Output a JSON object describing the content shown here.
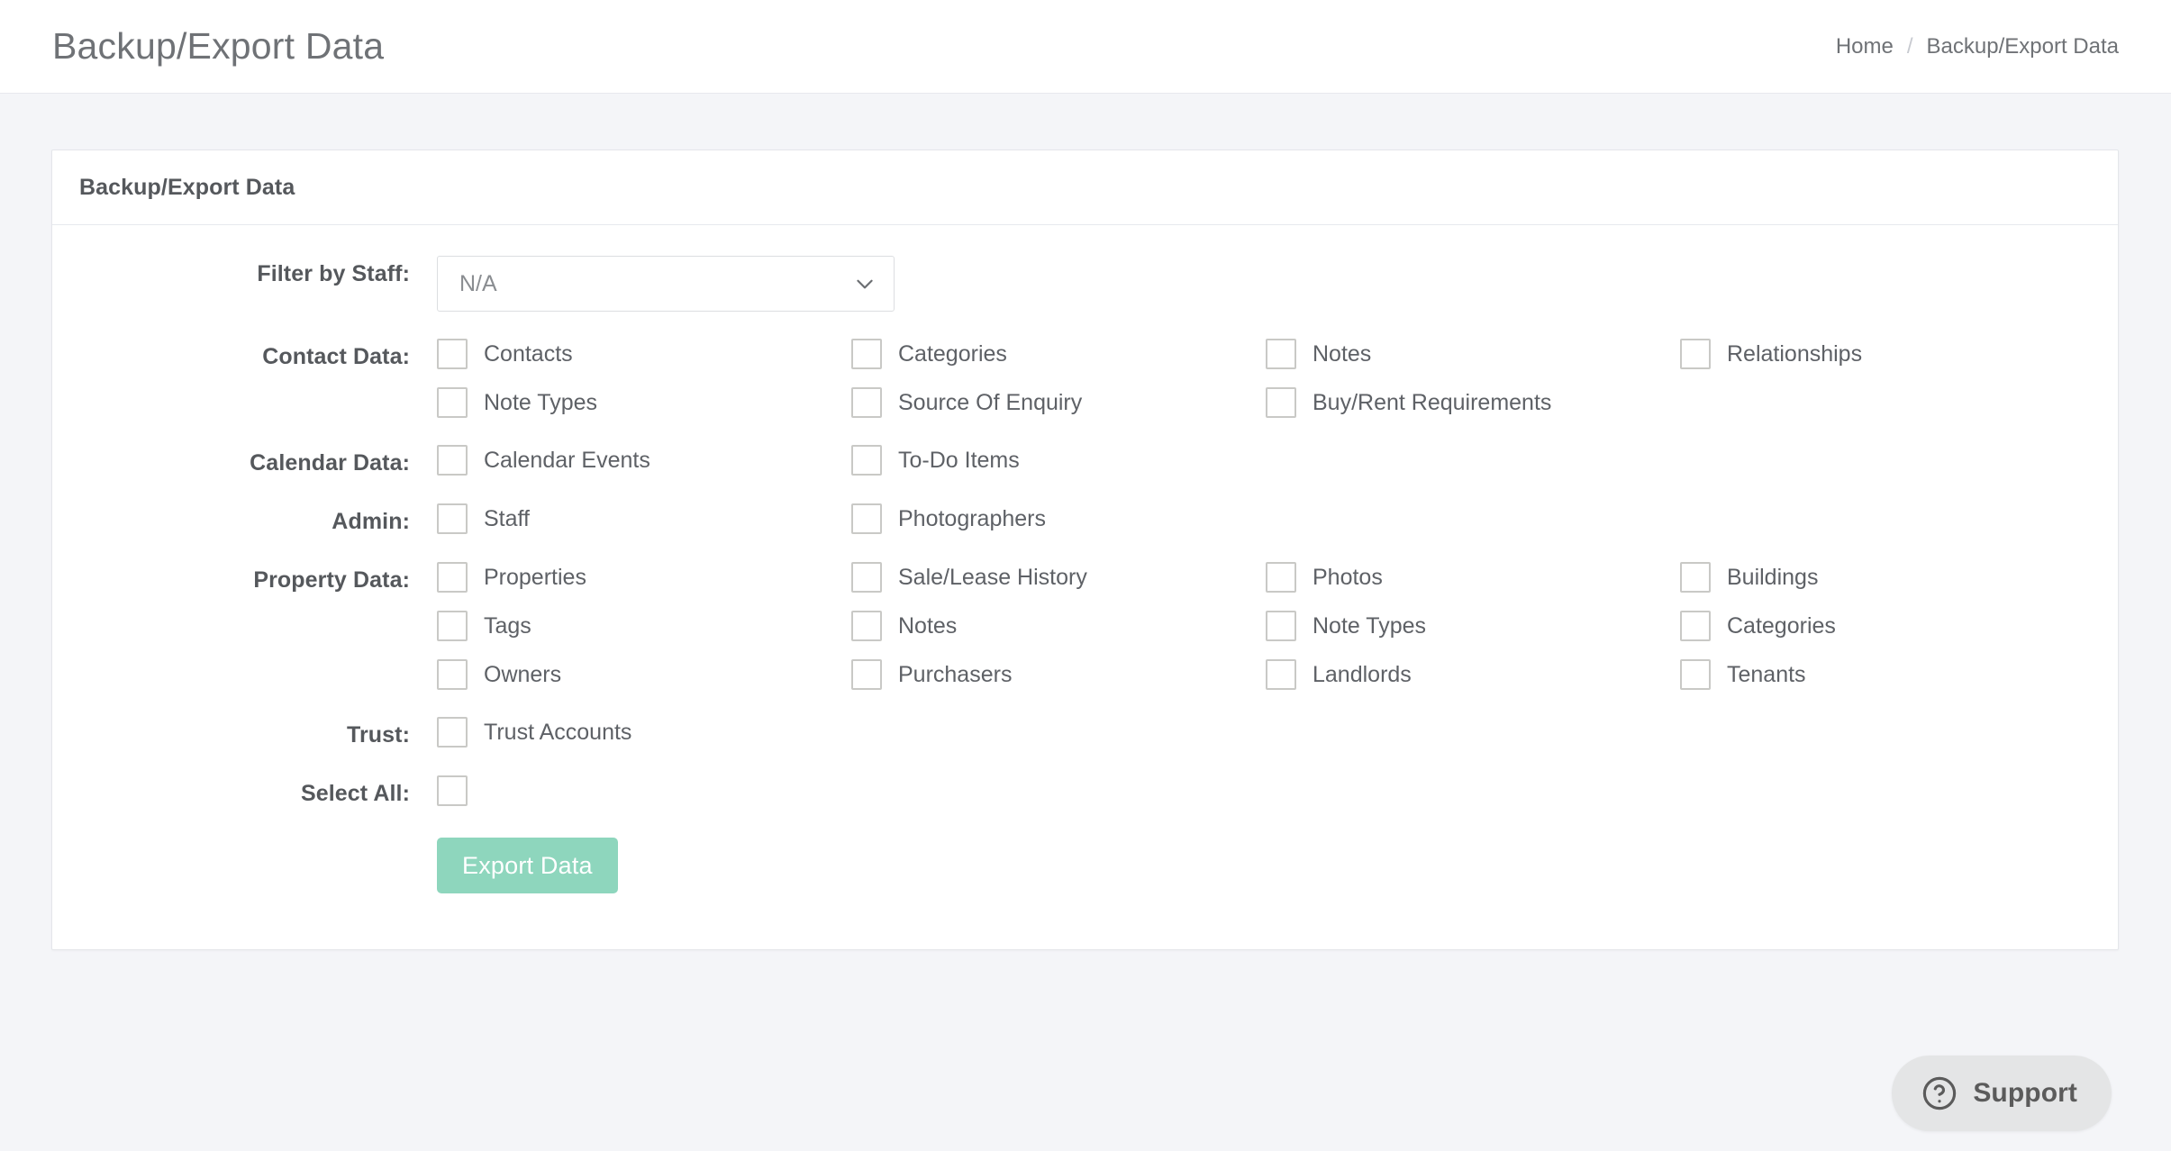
{
  "header": {
    "page_title": "Backup/Export Data",
    "breadcrumb": {
      "home": "Home",
      "separator": "/",
      "current": "Backup/Export Data"
    }
  },
  "card": {
    "title": "Backup/Export Data"
  },
  "form": {
    "filter_by_staff": {
      "label": "Filter by Staff:",
      "value": "N/A",
      "options": [
        "N/A"
      ]
    },
    "sections": [
      {
        "label": "Contact Data:",
        "items": [
          "Contacts",
          "Categories",
          "Notes",
          "Relationships",
          "Note Types",
          "Source Of Enquiry",
          "Buy/Rent Requirements"
        ]
      },
      {
        "label": "Calendar Data:",
        "items": [
          "Calendar Events",
          "To-Do Items"
        ]
      },
      {
        "label": "Admin:",
        "items": [
          "Staff",
          "Photographers"
        ]
      },
      {
        "label": "Property Data:",
        "items": [
          "Properties",
          "Sale/Lease History",
          "Photos",
          "Buildings",
          "Tags",
          "Notes",
          "Note Types",
          "Categories",
          "Owners",
          "Purchasers",
          "Landlords",
          "Tenants"
        ]
      },
      {
        "label": "Trust:",
        "items": [
          "Trust Accounts"
        ]
      }
    ],
    "select_all": {
      "label": "Select All:",
      "checked": false
    },
    "submit": {
      "label": "Export Data"
    }
  },
  "support": {
    "label": "Support",
    "icon": "question-circle-icon"
  },
  "colors": {
    "page_background": "#f4f5f8",
    "card_background": "#ffffff",
    "accent_button": "#8ed6bd",
    "text_strong": "#55585c",
    "text_normal": "#5e6166",
    "text_muted": "#8a8d91",
    "border": "#e4e6ea",
    "checkbox_border": "#c9c9c6",
    "support_background": "#e4e5e6"
  }
}
